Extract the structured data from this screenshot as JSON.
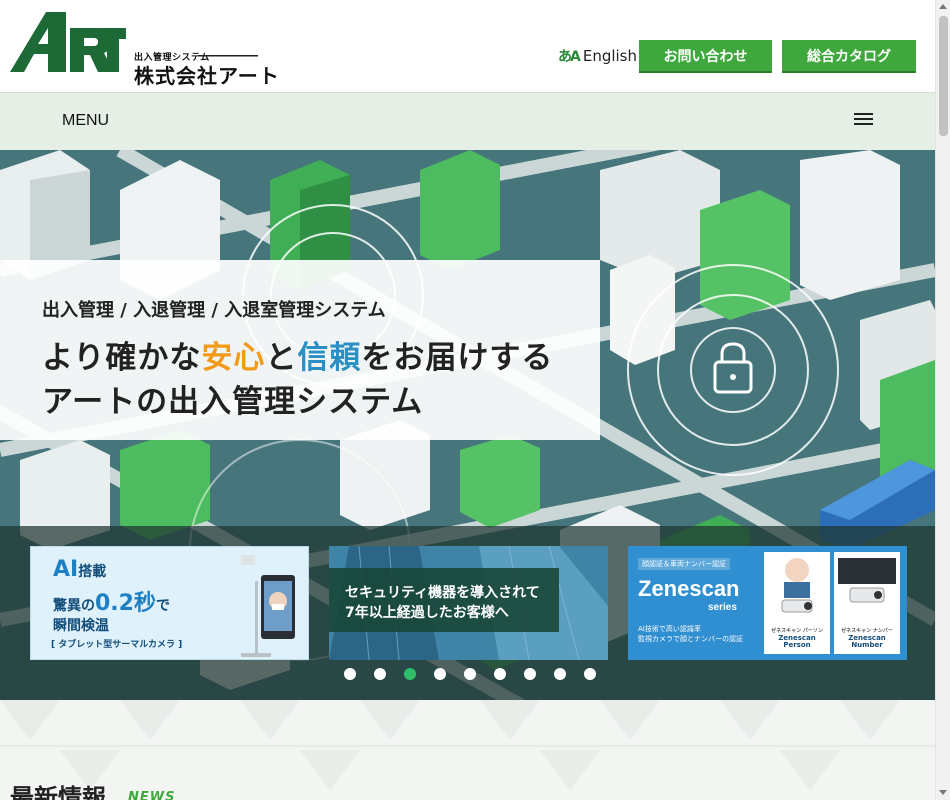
{
  "header": {
    "logo_mark": "ART",
    "logo_sub": "出入管理システム",
    "logo_company": "株式会社アート",
    "lang_icon": "あA",
    "lang_label": "English",
    "contact_label": "お問い合わせ",
    "catalog_label": "総合カタログ"
  },
  "menubar": {
    "label": "MENU",
    "icon": "hamburger-icon"
  },
  "hero": {
    "kicker": "出入管理 / 入退管理 / 入退室管理システム",
    "line1_pre": "より確かな",
    "line1_hl1": "安心",
    "line1_mid": "と",
    "line1_hl2": "信頼",
    "line1_post": "をお届けする",
    "line2": "アートの出入管理システム",
    "icons": [
      "face-recognition-icon",
      "lock-icon"
    ]
  },
  "carousel": {
    "slides": [
      {
        "t1": "AI",
        "t1b": "搭載",
        "t2a": "驚異の",
        "t2b": "0.2秒",
        "t2c": "で",
        "t3": "瞬間検温",
        "t4": "[ タブレット型サーマルカメラ ]"
      },
      {
        "t1": "セキュリティ機器を導入されて",
        "t2": "7年以上経過したお客様へ"
      },
      {
        "badge": "顔認証＆車両ナンバー認証",
        "title": "Zenescan",
        "series": "series",
        "desc1": "AI技術で高い認識率",
        "desc2": "監視カメラで顔とナンバーの認証",
        "card1_small": "ゼネスキャン パーソン",
        "card1_label": "Zenescan Person",
        "card2_small": "ゼネスキャン ナンバー",
        "card2_label": "Zenescan Number"
      }
    ],
    "dot_count": 9,
    "active_dot": 3
  },
  "news": {
    "title": "最新情報",
    "subtitle": "NEWS"
  },
  "colors": {
    "brand_green": "#3fa83d",
    "logo_green": "#1e6a36",
    "menu_bg": "#e6efe6",
    "accent_orange": "#f29b1b",
    "accent_blue": "#2a8fc4",
    "dot_active": "#2fbd6a"
  }
}
